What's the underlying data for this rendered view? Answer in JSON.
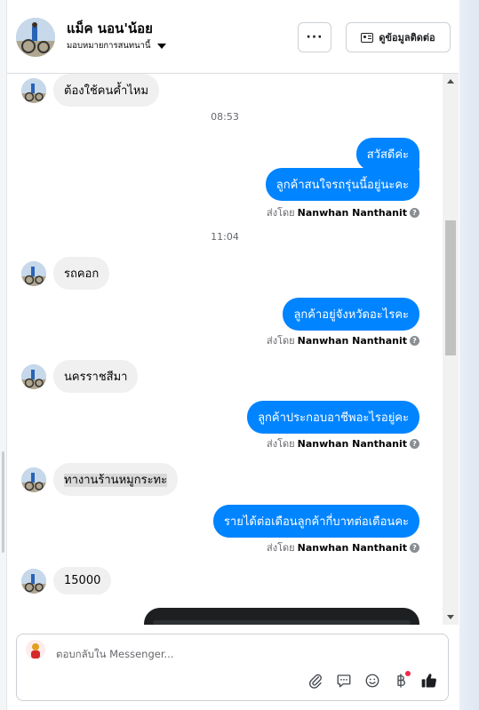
{
  "header": {
    "name": "แม็ค นอน'น้อย",
    "assign_label": "มอบหมายการสนทนานี้",
    "more_label": "···",
    "contact_label": "ดูข้อมูลติดต่อ"
  },
  "thread": {
    "messages": [
      {
        "side": "in",
        "text": "ต้องใช้คนค้ำไหม"
      },
      {
        "type": "time",
        "text": "08:53"
      },
      {
        "side": "out",
        "text": "สวัสดีค่ะ"
      },
      {
        "side": "out",
        "text": "ลูกค้าสนใจรถรุ่นนี้อยู่นะคะ"
      },
      {
        "type": "sentby",
        "prefix": "ส่งโดย",
        "name": "Nanwhan Nanthanit"
      },
      {
        "type": "time",
        "text": "11:04"
      },
      {
        "side": "in",
        "text": "รถคอก"
      },
      {
        "side": "out",
        "text": "ลูกค้าอยู่จังหวัดอะไรคะ"
      },
      {
        "type": "sentby",
        "prefix": "ส่งโดย",
        "name": "Nanwhan Nanthanit"
      },
      {
        "side": "in",
        "text": "นครราชสีมา"
      },
      {
        "side": "out",
        "text": "ลูกค้าประกอบอาชีพอะไรอยู่คะ"
      },
      {
        "type": "sentby",
        "prefix": "ส่งโดย",
        "name": "Nanwhan Nanthanit"
      },
      {
        "side": "in",
        "text": "ทางานร้านหมูกระทะ"
      },
      {
        "side": "out",
        "text": "รายได้ต่อเดือนลูกค้ากี่บาทต่อเดือนคะ"
      },
      {
        "type": "sentby",
        "prefix": "ส่งโดย",
        "name": "Nanwhan Nanthanit"
      },
      {
        "side": "in",
        "text": "15000"
      }
    ]
  },
  "composer": {
    "placeholder": "ตอบกลับใน Messenger..."
  },
  "icons": {
    "attach": "paperclip-icon",
    "saved_replies": "chat-bubble-icon",
    "emoji": "smiley-icon",
    "payment": "baht-icon",
    "like": "thumbs-up-icon"
  },
  "colors": {
    "outgoing_bubble": "#0084ff",
    "incoming_bubble": "#f0f0f0",
    "notification_dot": "#f02849"
  }
}
